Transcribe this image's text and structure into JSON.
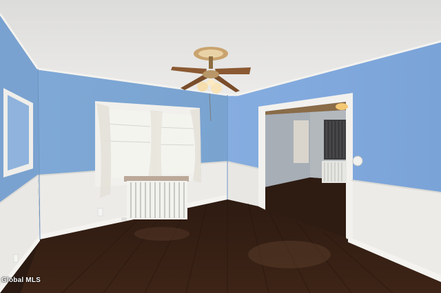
{
  "photo": {
    "watermark": "Global MLS",
    "colors": {
      "ceiling": "#e6e6e4",
      "wall_blue": "#7da7d4",
      "wainscot": "#ecebe8",
      "floor": "#3a2418",
      "window_light": "#f4f4ef"
    }
  }
}
